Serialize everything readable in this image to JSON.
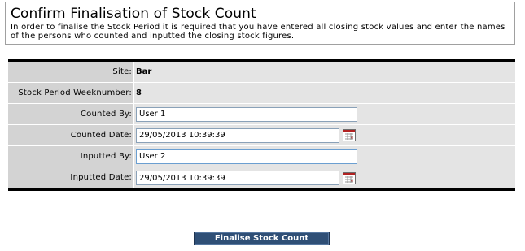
{
  "header": {
    "title": "Confirm Finalisation of Stock Count",
    "intro": "In order to finalise the Stock Period it is required that you have entered all closing stock values and enter the names of the persons who counted and inputted the closing stock figures."
  },
  "form": {
    "site": {
      "label": "Site:",
      "value": "Bar"
    },
    "weeknumber": {
      "label": "Stock Period Weeknumber:",
      "value": "8"
    },
    "counted_by": {
      "label": "Counted By:",
      "value": "User 1"
    },
    "counted_date": {
      "label": "Counted Date:",
      "value": "29/05/2013 10:39:39",
      "icon": "calendar-icon"
    },
    "inputted_by": {
      "label": "Inputted By:",
      "value": "User 2"
    },
    "inputted_date": {
      "label": "Inputted Date:",
      "value": "29/05/2013 10:39:39",
      "icon": "calendar-icon"
    }
  },
  "actions": {
    "finalise_label": "Finalise Stock Count"
  },
  "colors": {
    "button_bg": "#2f4f76",
    "label_bg": "#d3d3d3",
    "value_bg": "#e4e4e4"
  }
}
